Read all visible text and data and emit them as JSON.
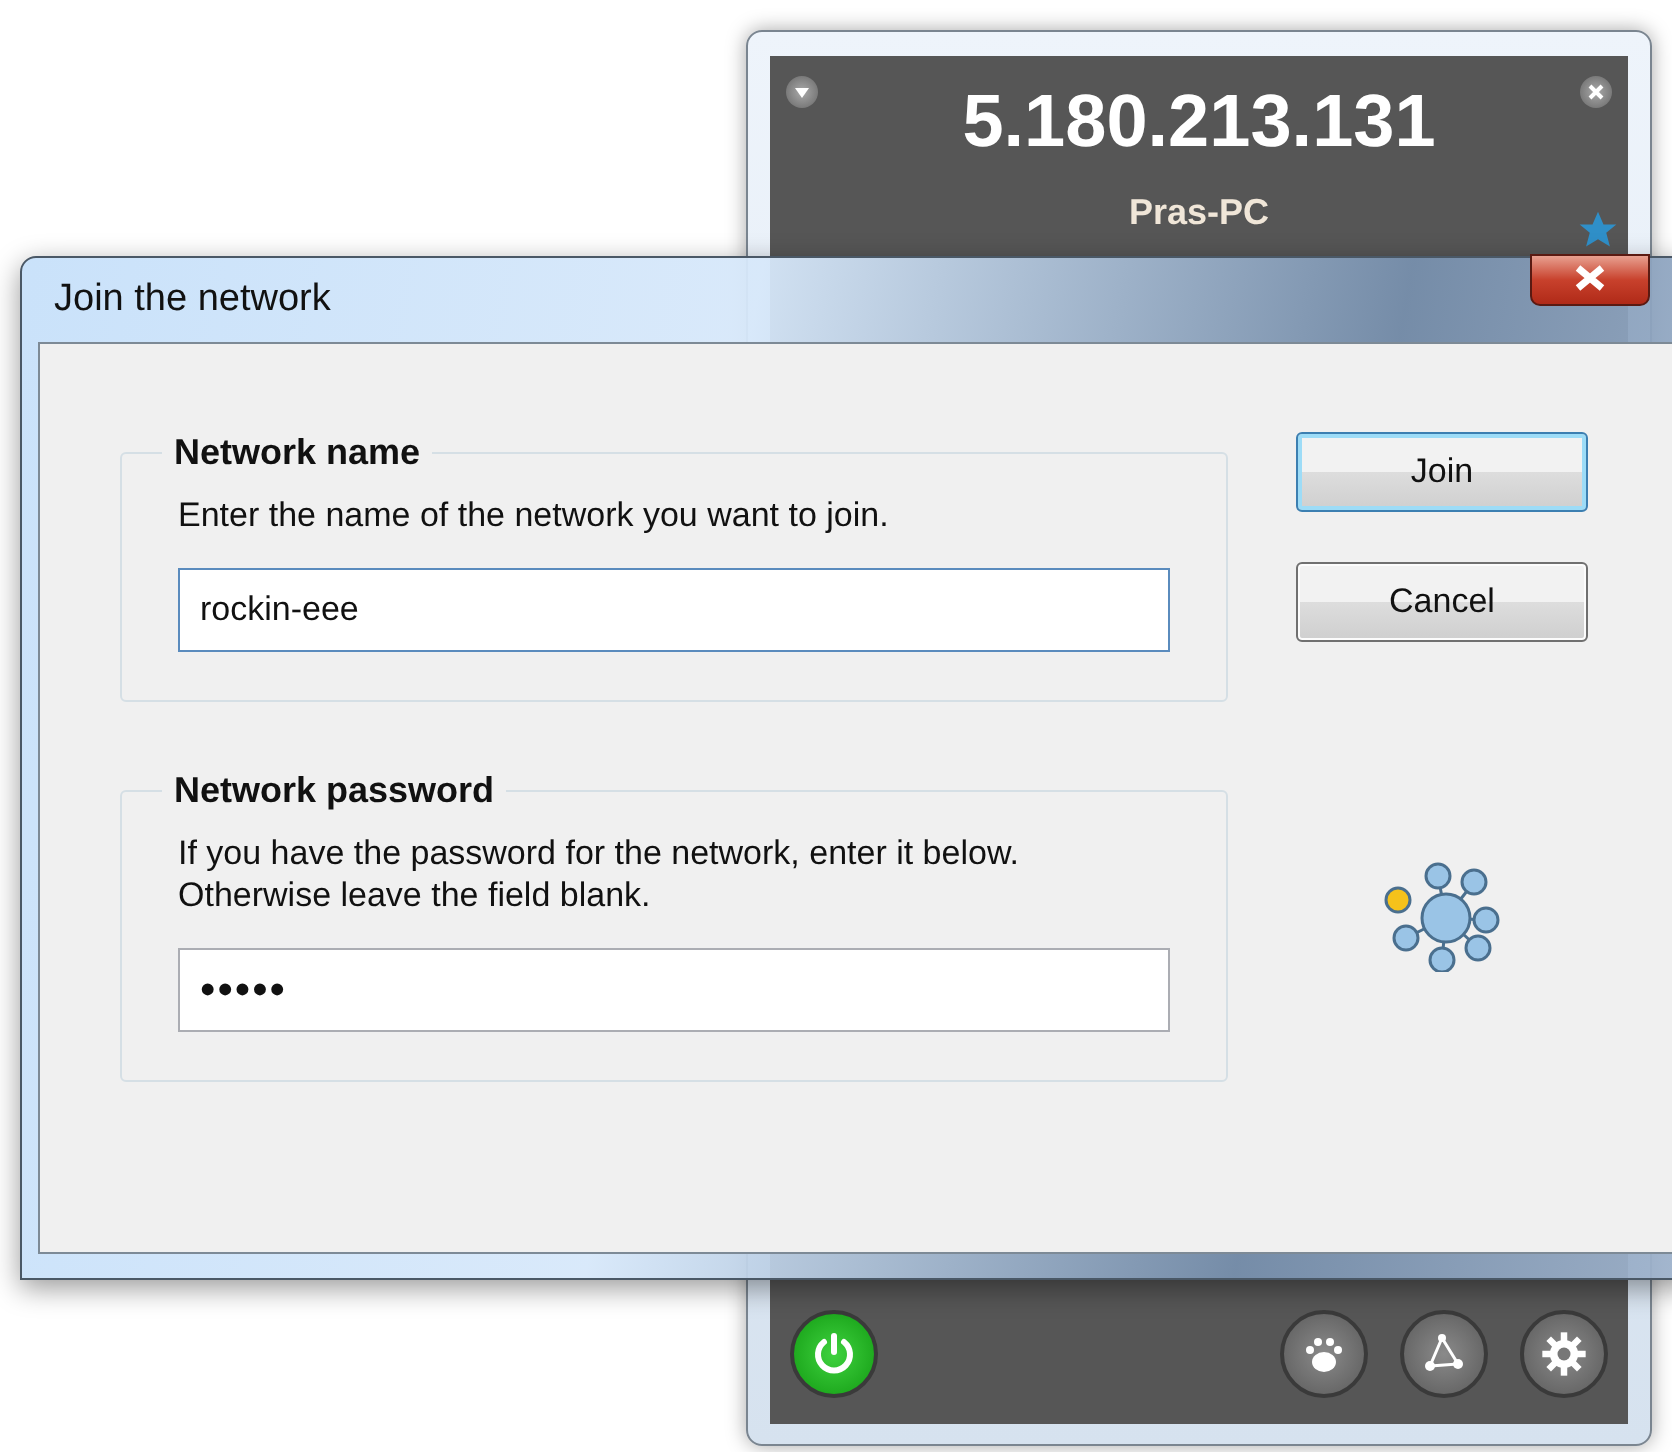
{
  "hamachi": {
    "address": "5.180.213.131",
    "name": "Pras-PC",
    "favorite": true,
    "power_on": true
  },
  "dialog": {
    "title": "Join the network",
    "groups": [
      {
        "legend": "Network name",
        "description": "Enter the name of the network you want to join.",
        "value": "rockin-eee",
        "kind": "text",
        "focused": true
      },
      {
        "legend": "Network password",
        "description": "If you have the password for the network, enter it below. Otherwise leave the field blank.",
        "value": "•••••",
        "kind": "password",
        "focused": false
      }
    ],
    "buttons": [
      {
        "label": "Join",
        "default": true
      },
      {
        "label": "Cancel",
        "default": false
      }
    ]
  }
}
